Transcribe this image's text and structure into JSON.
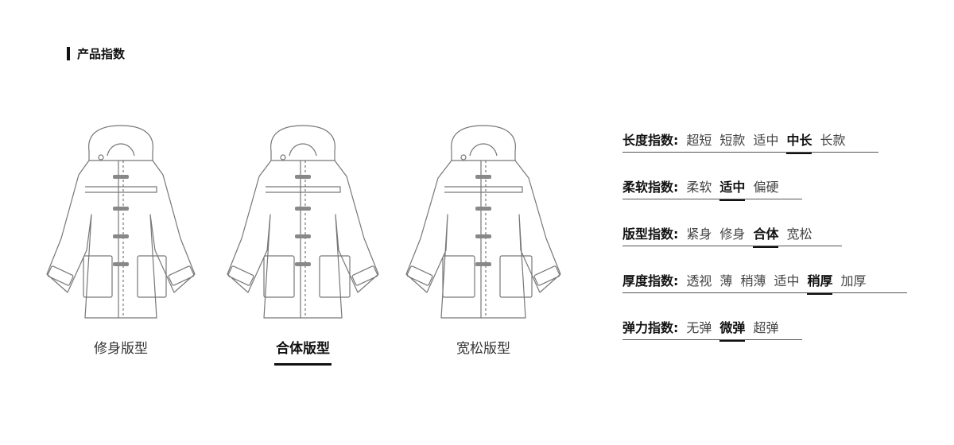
{
  "section_title": "产品指数",
  "fits": [
    {
      "label": "修身版型",
      "selected": false
    },
    {
      "label": "合体版型",
      "selected": true
    },
    {
      "label": "宽松版型",
      "selected": false
    }
  ],
  "indices": [
    {
      "name": "长度指数:",
      "options": [
        "超短",
        "短款",
        "适中",
        "中长",
        "长款"
      ],
      "selected": "中长"
    },
    {
      "name": "柔软指数:",
      "options": [
        "柔软",
        "适中",
        "偏硬"
      ],
      "selected": "适中"
    },
    {
      "name": "版型指数:",
      "options": [
        "紧身",
        "修身",
        "合体",
        "宽松"
      ],
      "selected": "合体"
    },
    {
      "name": "厚度指数:",
      "options": [
        "透视",
        "薄",
        "稍薄",
        "适中",
        "稍厚",
        "加厚"
      ],
      "selected": "稍厚"
    },
    {
      "name": "弹力指数:",
      "options": [
        "无弹",
        "微弹",
        "超弹"
      ],
      "selected": "微弹"
    }
  ]
}
